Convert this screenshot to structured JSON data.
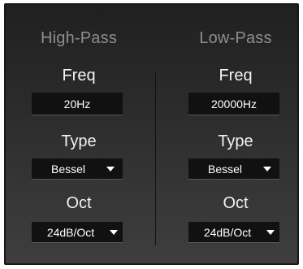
{
  "high_pass": {
    "title": "High-Pass",
    "freq_label": "Freq",
    "freq_value": "20Hz",
    "type_label": "Type",
    "type_value": "Bessel",
    "oct_label": "Oct",
    "oct_value": "24dB/Oct"
  },
  "low_pass": {
    "title": "Low-Pass",
    "freq_label": "Freq",
    "freq_value": "20000Hz",
    "type_label": "Type",
    "type_value": "Bessel",
    "oct_label": "Oct",
    "oct_value": "24dB/Oct"
  },
  "icons": {
    "dropdown": "chevron-down-icon"
  },
  "colors": {
    "panel_bg": "#2a2a2a",
    "field_bg": "#111111",
    "title_text": "#8e8e8e",
    "label_text": "#f2f2f2",
    "value_text": "#ffffff"
  }
}
